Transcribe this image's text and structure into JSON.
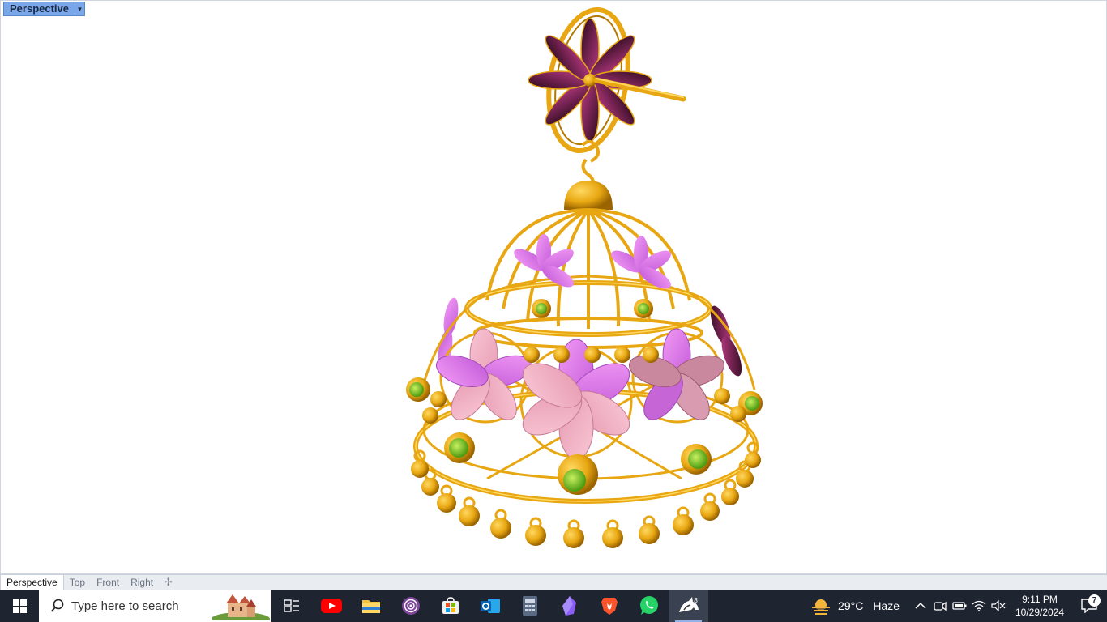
{
  "viewport": {
    "label": "Perspective",
    "dropdown_icon": "caret-down-icon"
  },
  "viewport_tabs": {
    "items": [
      {
        "label": "Perspective",
        "active": true
      },
      {
        "label": "Top",
        "active": false
      },
      {
        "label": "Front",
        "active": false
      },
      {
        "label": "Right",
        "active": false
      }
    ],
    "add_icon": "add-tab-icon"
  },
  "model": {
    "description_icon": "jhumka-earring-model",
    "colors": {
      "gold": "#e8a712",
      "gold_dark": "#a66d00",
      "pink": "#f0a5c0",
      "violet": "#d86de8",
      "green": "#7ccc22",
      "plum": "#9a2d6a"
    }
  },
  "taskbar": {
    "search_placeholder": "Type here to search",
    "apps": [
      "task-view-icon",
      "youtube-icon",
      "file-explorer-icon",
      "tor-browser-icon",
      "microsoft-store-icon",
      "outlook-icon",
      "calculator-icon",
      "obsidian-icon",
      "brave-icon",
      "whatsapp-icon",
      "rhino-8-icon"
    ],
    "weather": {
      "temp": "29°C",
      "condition": "Haze"
    },
    "clock": {
      "time": "9:11 PM",
      "date": "10/29/2024"
    },
    "notifications": "7"
  }
}
